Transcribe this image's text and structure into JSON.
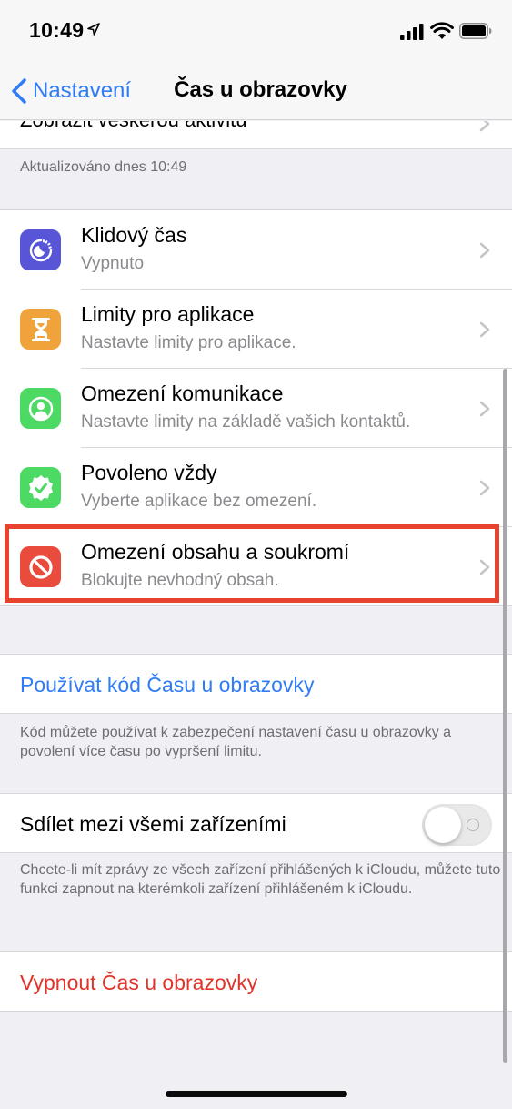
{
  "status_bar": {
    "time": "10:49",
    "icons": [
      "location-arrow-icon",
      "cellular-signal-icon",
      "wifi-icon",
      "battery-icon"
    ]
  },
  "nav": {
    "back_label": "Nastavení",
    "title": "Čas u obrazovky"
  },
  "top_row": {
    "label": "Zobrazit veškerou aktivitu"
  },
  "updated_text": "Aktualizováno dnes 10:49",
  "settings_rows": [
    {
      "title": "Klidový čas",
      "subtitle": "Vypnuto",
      "icon": "downtime-icon",
      "icon_color": "#5856d6"
    },
    {
      "title": "Limity pro aplikace",
      "subtitle": "Nastavte limity pro aplikace.",
      "icon": "hourglass-icon",
      "icon_color": "#f0a33a"
    },
    {
      "title": "Omezení komunikace",
      "subtitle": "Nastavte limity na základě vašich kontaktů.",
      "icon": "contact-icon",
      "icon_color": "#4cd964"
    },
    {
      "title": "Povoleno vždy",
      "subtitle": "Vyberte aplikace bez omezení.",
      "icon": "checkmark-badge-icon",
      "icon_color": "#4cd964"
    },
    {
      "title": "Omezení obsahu a soukromí",
      "subtitle": "Blokujte nevhodný obsah.",
      "icon": "restriction-icon",
      "icon_color": "#e94c3d"
    }
  ],
  "highlight_color": "#e8432f",
  "passcode": {
    "label": "Používat kód Času u obrazovky",
    "footer": "Kód můžete používat k zabezpečení nastavení času u obrazovky a povolení více času po vypršení limitu."
  },
  "share": {
    "label": "Sdílet mezi všemi zařízeními",
    "enabled": false,
    "footer": "Chcete-li mít zprávy ze všech zařízení přihlášených k iCloudu, můžete tuto funkci zapnout na kterémkoli zařízení přihlášeném k iCloudu."
  },
  "turn_off": {
    "label": "Vypnout Čas u obrazovky"
  },
  "colors": {
    "link_blue": "#2f7cf6",
    "destructive_red": "#e0342a"
  }
}
